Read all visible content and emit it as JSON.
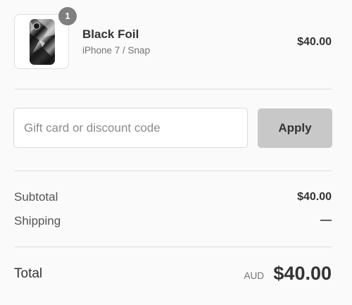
{
  "product": {
    "quantity": "1",
    "name": "Black Foil",
    "variant": "iPhone 7 / Snap",
    "price": "$40.00",
    "image_icon": "phone-case-image"
  },
  "discount": {
    "placeholder": "Gift card or discount code",
    "value": "",
    "apply_label": "Apply"
  },
  "summary": {
    "subtotal_label": "Subtotal",
    "subtotal_value": "$40.00",
    "shipping_label": "Shipping",
    "shipping_value": "—",
    "total_label": "Total",
    "currency": "AUD",
    "total_value": "$40.00"
  },
  "colors": {
    "background": "#fafafa",
    "badge": "#7f7f7f",
    "apply_button": "#c8c8c8",
    "text_primary": "#333333",
    "text_secondary": "#737373"
  }
}
